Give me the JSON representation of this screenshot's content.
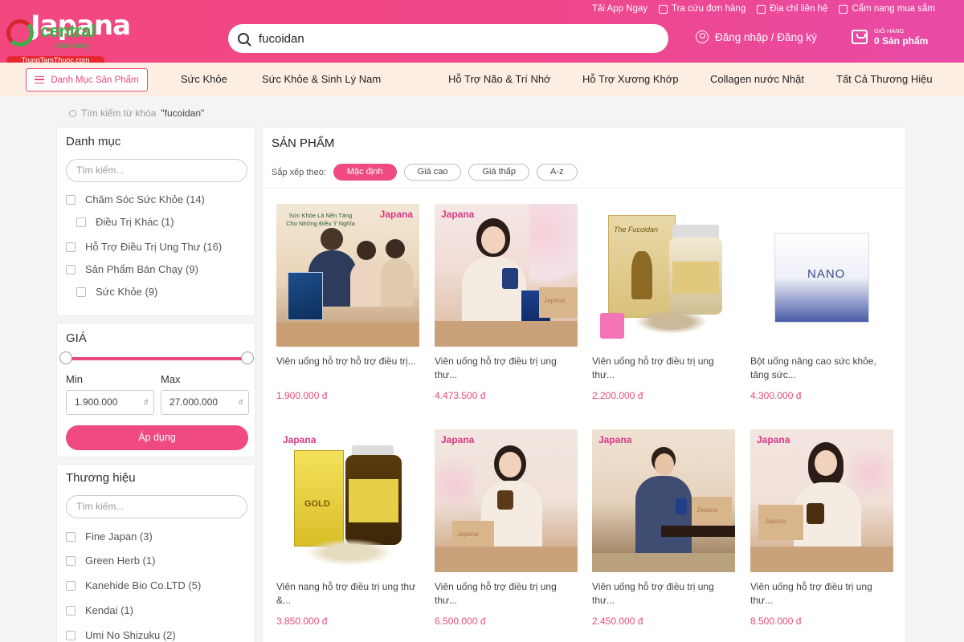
{
  "header": {
    "logo_text": "Japana",
    "partner_logo": {
      "word": "central",
      "sub": "pharmacy",
      "site": "TrungTamThuoc.com"
    },
    "top_links": [
      "Tải App Ngay",
      "Tra cứu đơn hàng",
      "Địa chỉ liên hệ",
      "Cẩm nang mua sắm"
    ],
    "search_value": "fucoidan",
    "login_label": "Đăng nhập / Đăng ký",
    "cart": {
      "label": "GIỎ HÀNG",
      "count": "0 Sản phẩm"
    }
  },
  "nav": {
    "category_button": "Danh Mục Sản Phẩm",
    "items": [
      "Sức Khỏe",
      "Sức Khỏe & Sinh Lý Nam",
      "Hỗ Trợ Não & Trí Nhớ",
      "Hỗ Trợ Xương Khớp",
      "Collagen nước Nhật",
      "Tất Cả Thương Hiệu"
    ]
  },
  "breadcrumb": {
    "prefix": "Tìm kiếm từ khóa",
    "query": "\"fucoidan\""
  },
  "sidebar": {
    "category": {
      "title": "Danh mục",
      "search_placeholder": "Tìm kiếm...",
      "items": [
        {
          "label": "Chăm Sóc Sức Khỏe (14)"
        },
        {
          "label": "Điều Trị Khác (1)"
        },
        {
          "label": "Hỗ Trợ Điều Trị Ung Thư (16)"
        },
        {
          "label": "Sản Phẩm Bán Chạy (9)"
        },
        {
          "label": "Sức Khỏe (9)"
        }
      ]
    },
    "price": {
      "title": "GIÁ",
      "min_label": "Min",
      "max_label": "Max",
      "min_value": "1.900.000",
      "max_value": "27.000.000",
      "currency": "đ",
      "apply_label": "Áp dụng"
    },
    "brand": {
      "title": "Thương hiệu",
      "search_placeholder": "Tìm kiếm...",
      "items": [
        {
          "label": "Fine Japan (3)"
        },
        {
          "label": "Green Herb (1)"
        },
        {
          "label": "Kanehide Bio Co.LTD (5)"
        },
        {
          "label": "Kendai (1)"
        },
        {
          "label": "Umi No Shizuku (2)"
        }
      ]
    }
  },
  "main": {
    "title": "SẢN PHẨM",
    "sort_label": "Sắp xếp theo:",
    "sort_options": [
      "Mặc định",
      "Giá cao",
      "Giá thấp",
      "A-z"
    ],
    "products": [
      {
        "name": "Viên uống hỗ trợ hỗ trợ điều trị...",
        "price": "1.900.000 đ",
        "image_labels": [
          "Sức Khỏe Là Nền Tảng",
          "Cho Những Điều Ý Nghĩa",
          "Japana"
        ]
      },
      {
        "name": "Viên uống hỗ trợ điều trị ung thư...",
        "price": "4.473.500 đ",
        "image_labels": [
          "Japana",
          "Japana"
        ]
      },
      {
        "name": "Viên uống hỗ trợ điều trị ung thư...",
        "price": "2.200.000 đ",
        "image_labels": [
          "The Fucoidan"
        ]
      },
      {
        "name": "Bột uống nâng cao sức khỏe, tăng sức...",
        "price": "4.300.000 đ",
        "image_labels": [
          "NANO"
        ]
      },
      {
        "name": "Viên nang hỗ trợ điều trị ung thư &...",
        "price": "3.850.000 đ",
        "image_labels": [
          "Japana",
          "GOLD"
        ]
      },
      {
        "name": "Viên uống hỗ trợ điều trị ung thư...",
        "price": "6.500.000 đ",
        "image_labels": [
          "Japana",
          "Japana"
        ]
      },
      {
        "name": "Viên uống hỗ trợ điều trị ung thư...",
        "price": "2.450.000 đ",
        "image_labels": [
          "Japana",
          "Japana"
        ]
      },
      {
        "name": "Viên uống hỗ trợ điều trị ung thư...",
        "price": "8.500.000 đ",
        "image_labels": [
          "Japana",
          "Japana"
        ]
      }
    ]
  },
  "colors": {
    "brand_pink": "#f04a82",
    "nav_bg": "#fdeee4",
    "price": "#e94b7c"
  }
}
